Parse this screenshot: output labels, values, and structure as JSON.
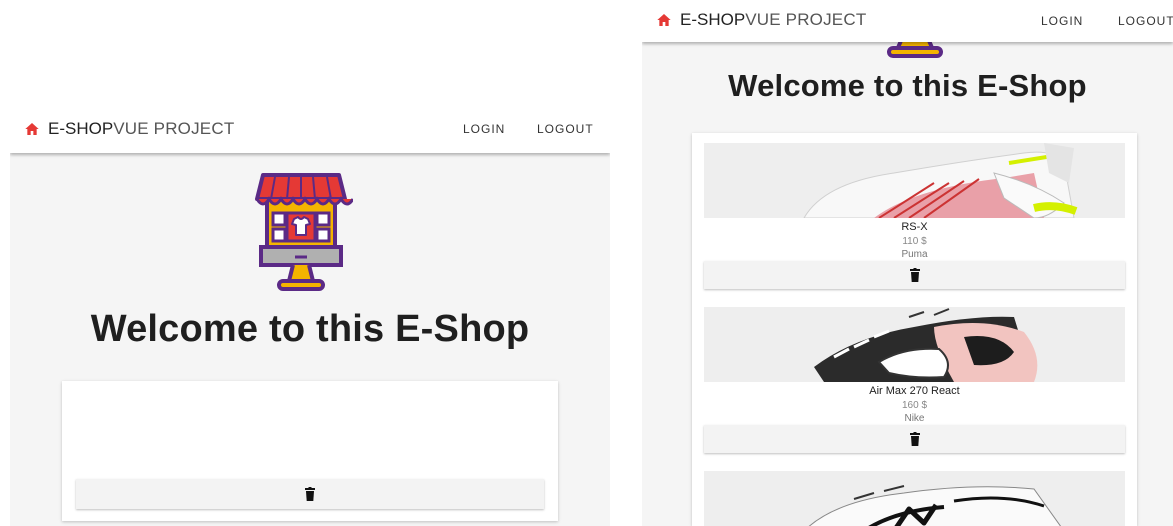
{
  "brand": {
    "strong": "E-SHOP",
    "rest": "VUE PROJECT"
  },
  "nav": {
    "login": "LOGIN",
    "logout": "LOGOUT"
  },
  "welcome": "Welcome to this E-Shop",
  "colors": {
    "accent": "#e53935",
    "store_purple": "#5b2a86",
    "awning_red": "#e53935",
    "store_yellow": "#f4b400",
    "screen_gray": "#b0b0b0"
  },
  "icons": {
    "home": "home-icon",
    "delete": "trash-icon",
    "logo": "shop-storefront-logo"
  },
  "products": [
    {
      "name": "RS-X",
      "price": "110 $",
      "brand": "Puma"
    },
    {
      "name": "Air Max 270 React",
      "price": "160 $",
      "brand": "Nike"
    },
    {
      "name": "",
      "price": "",
      "brand": ""
    }
  ]
}
